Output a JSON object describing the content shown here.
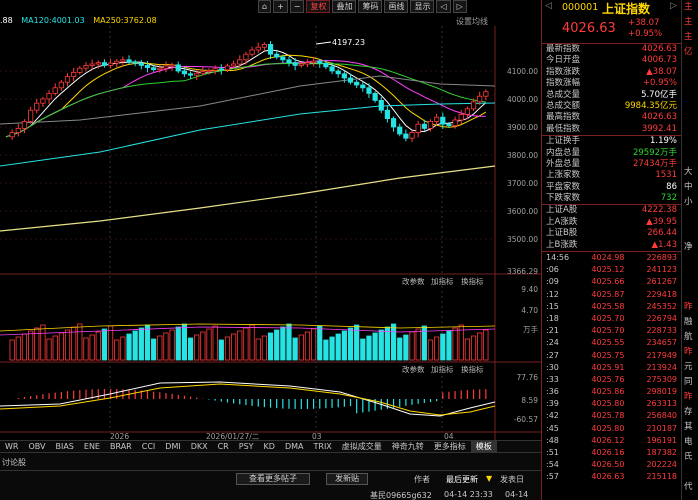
{
  "chart_header": {
    "ma_left": ".88",
    "ma120": "MA120:4001.03",
    "ma250": "MA250:3762.08",
    "settings": "设置均线"
  },
  "toolbar": [
    "⌂",
    "+",
    "−",
    "复权",
    "叠加",
    "筹码",
    "画线",
    "显示",
    "◁",
    "▷"
  ],
  "toolbar_active": 3,
  "price_axis": [
    "4100.00",
    "4000.00",
    "3900.00",
    "3800.00",
    "3700.00",
    "3600.00",
    "3500.00",
    "3366.29"
  ],
  "peak_label": "4197.23",
  "vol_axis": [
    "9.40",
    "4.70",
    "万手"
  ],
  "macd_axis": [
    "77.76",
    "8.59",
    "-60.57"
  ],
  "sub_panel_labels": {
    "vol": [
      "改参数",
      "加指标",
      "换指标"
    ],
    "macd": [
      "改参数",
      "加指标",
      "换指标"
    ]
  },
  "date_labels": [
    "2026",
    "2026/01/27/二",
    "03",
    "04"
  ],
  "indicator_tabs": [
    "WR",
    "OBV",
    "BIAS",
    "ENE",
    "BRAR",
    "CCI",
    "DMI",
    "DKX",
    "CR",
    "PSY",
    "KD",
    "DMA",
    "TRIX",
    "虚拟成交量",
    "神奇九转",
    "更多指标",
    "模板"
  ],
  "bottom": {
    "forum": "讨论股",
    "more_posts": "查看更多帖子",
    "post": "发新贴",
    "author": "作者",
    "latest": "最后更新",
    "posted": "发表日",
    "user": "基民09665g632",
    "time1": "04-14  23:33",
    "time2": "04-14"
  },
  "quote": {
    "code": "000001",
    "name": "上证指数",
    "price": "4026.63",
    "change": "+38.07",
    "pct": "+0.95%"
  },
  "stats": [
    {
      "k": "最新指数",
      "v": "4026.63",
      "c": "red"
    },
    {
      "k": "今日开盘",
      "v": "4006.73",
      "c": "red"
    },
    {
      "k": "指数涨跌",
      "v": "▲38.07",
      "c": "red"
    },
    {
      "k": "指数涨幅",
      "v": "+0.95%",
      "c": "red"
    },
    {
      "k": "总成交量",
      "v": "5.70亿手",
      "c": "white"
    },
    {
      "k": "总成交额",
      "v": "9984.35亿元",
      "c": "yellow"
    },
    {
      "k": "最高指数",
      "v": "4026.63",
      "c": "red"
    },
    {
      "k": "最低指数",
      "v": "3992.41",
      "c": "red"
    }
  ],
  "stats2": [
    {
      "k": "上证换手",
      "v": "1.19%",
      "c": "white"
    },
    {
      "k": "内盘总量",
      "v": "29592万手",
      "c": "green"
    },
    {
      "k": "外盘总量",
      "v": "27434万手",
      "c": "red"
    },
    {
      "k": "上涨家数",
      "v": "1531",
      "c": "red"
    },
    {
      "k": "平盘家数",
      "v": "86",
      "c": "white"
    },
    {
      "k": "下跌家数",
      "v": "732",
      "c": "green"
    }
  ],
  "stats3": [
    {
      "k": "上证A股",
      "v": "4222.38",
      "c": "red"
    },
    {
      "k": "上A涨跌",
      "v": "▲39.95",
      "c": "red"
    },
    {
      "k": "上证B股",
      "v": "266.44",
      "c": "red"
    },
    {
      "k": "上B涨跌",
      "v": "▲1.43",
      "c": "red"
    }
  ],
  "trades": [
    [
      "14:56",
      "4024.98",
      "226893"
    ],
    [
      ":06",
      "4025.12",
      "241123"
    ],
    [
      ":09",
      "4025.66",
      "261267"
    ],
    [
      ":12",
      "4025.87",
      "229418"
    ],
    [
      ":15",
      "4025.58",
      "245352"
    ],
    [
      ":18",
      "4025.70",
      "226794"
    ],
    [
      ":21",
      "4025.70",
      "228733"
    ],
    [
      ":24",
      "4025.55",
      "234657"
    ],
    [
      ":27",
      "4025.75",
      "217949"
    ],
    [
      ":30",
      "4025.91",
      "213924"
    ],
    [
      ":33",
      "4025.76",
      "275309"
    ],
    [
      ":36",
      "4025.86",
      "298019"
    ],
    [
      ":39",
      "4025.80",
      "263313"
    ],
    [
      ":42",
      "4025.78",
      "256840"
    ],
    [
      ":45",
      "4025.80",
      "210187"
    ],
    [
      ":48",
      "4026.12",
      "196191"
    ],
    [
      ":51",
      "4026.16",
      "187382"
    ],
    [
      ":54",
      "4026.50",
      "202224"
    ],
    [
      ":57",
      "4026.63",
      "215118"
    ]
  ],
  "far_right": [
    "主",
    "主",
    "主",
    "亿",
    "",
    "",
    "",
    "",
    "",
    "",
    "",
    "大",
    "中",
    "小",
    "",
    "",
    "净",
    "",
    "",
    "",
    "昨",
    "融",
    "航",
    "昨",
    "元",
    "同",
    "昨",
    "存",
    "其",
    "电",
    "氏",
    "",
    "代"
  ]
}
